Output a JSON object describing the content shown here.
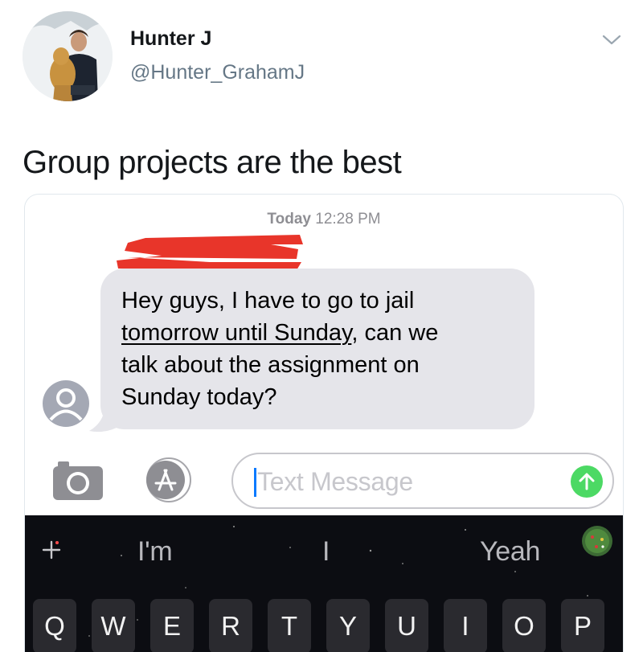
{
  "tweet": {
    "author_name": "Hunter J",
    "author_handle": "@Hunter_GrahamJ",
    "text": "Group projects are the best"
  },
  "messages": {
    "timestamp_day": "Today",
    "timestamp_time": "12:28 PM",
    "bubble_lines": [
      "Hey guys, I have to go to jail",
      "tomorrow until Sunday",
      ", can we",
      "talk about the assignment on",
      "Sunday today?"
    ],
    "input_placeholder": "Text Message"
  },
  "keyboard": {
    "suggestions": [
      "I'm",
      "I",
      "Yeah"
    ],
    "top_row_keys": [
      "Q",
      "W",
      "E",
      "R",
      "T",
      "Y",
      "U",
      "I",
      "O",
      "P"
    ]
  },
  "icons": {
    "more": "chevron-down-icon",
    "camera": "camera-icon",
    "appstore": "app-store-icon",
    "send": "arrow-up-icon",
    "plus": "plus-icon",
    "memoji": "memoji-icon",
    "contact": "person-icon"
  },
  "colors": {
    "bubble": "#e5e5ea",
    "send": "#4cd964",
    "cursor": "#0a7aff",
    "redaction": "#e8352a"
  }
}
